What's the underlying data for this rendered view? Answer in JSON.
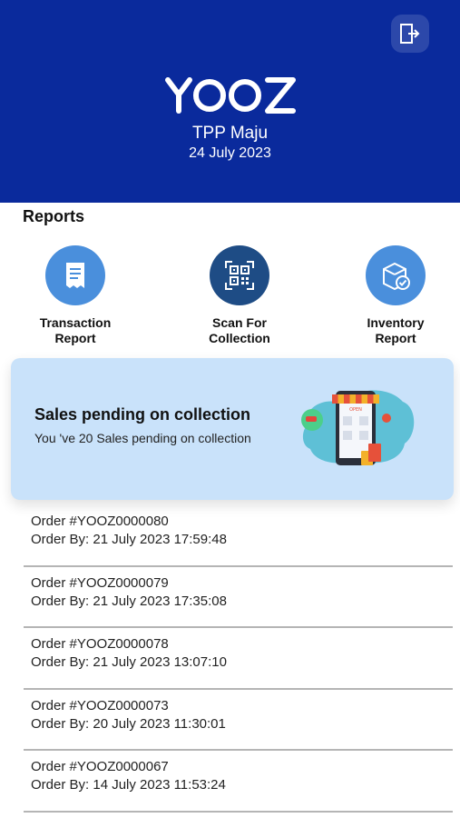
{
  "header": {
    "logo_text": "YOOZ",
    "store_name": "TPP Maju",
    "date": "24 July 2023",
    "logout_icon": "logout-icon"
  },
  "reports": {
    "title": "Reports",
    "items": [
      {
        "label": "Transaction\nReport",
        "icon": "receipt-icon",
        "color": "#4a8fdc"
      },
      {
        "label": "Scan For\nCollection",
        "icon": "qr-code-icon",
        "color": "#1e4c85"
      },
      {
        "label": "Inventory\nReport",
        "icon": "inventory-icon",
        "color": "#4a8fdc"
      }
    ]
  },
  "banner": {
    "title": "Sales pending on collection",
    "subtitle": "You 've 20 Sales pending on collection",
    "art_sign_text": "OPEN"
  },
  "orders": [
    {
      "id": "Order #YOOZ0000080",
      "by": "Order By: 21 July 2023 17:59:48"
    },
    {
      "id": "Order #YOOZ0000079",
      "by": "Order By: 21 July 2023 17:35:08"
    },
    {
      "id": "Order #YOOZ0000078",
      "by": "Order By: 21 July 2023 13:07:10"
    },
    {
      "id": "Order #YOOZ0000073",
      "by": "Order By: 20 July 2023 11:30:01"
    },
    {
      "id": "Order #YOOZ0000067",
      "by": "Order By: 14 July 2023 11:53:24"
    }
  ],
  "colors": {
    "header_bg": "#0a2a9c",
    "banner_bg": "#c9e2fa",
    "accent_light": "#4a8fdc",
    "accent_dark": "#1e4c85"
  }
}
